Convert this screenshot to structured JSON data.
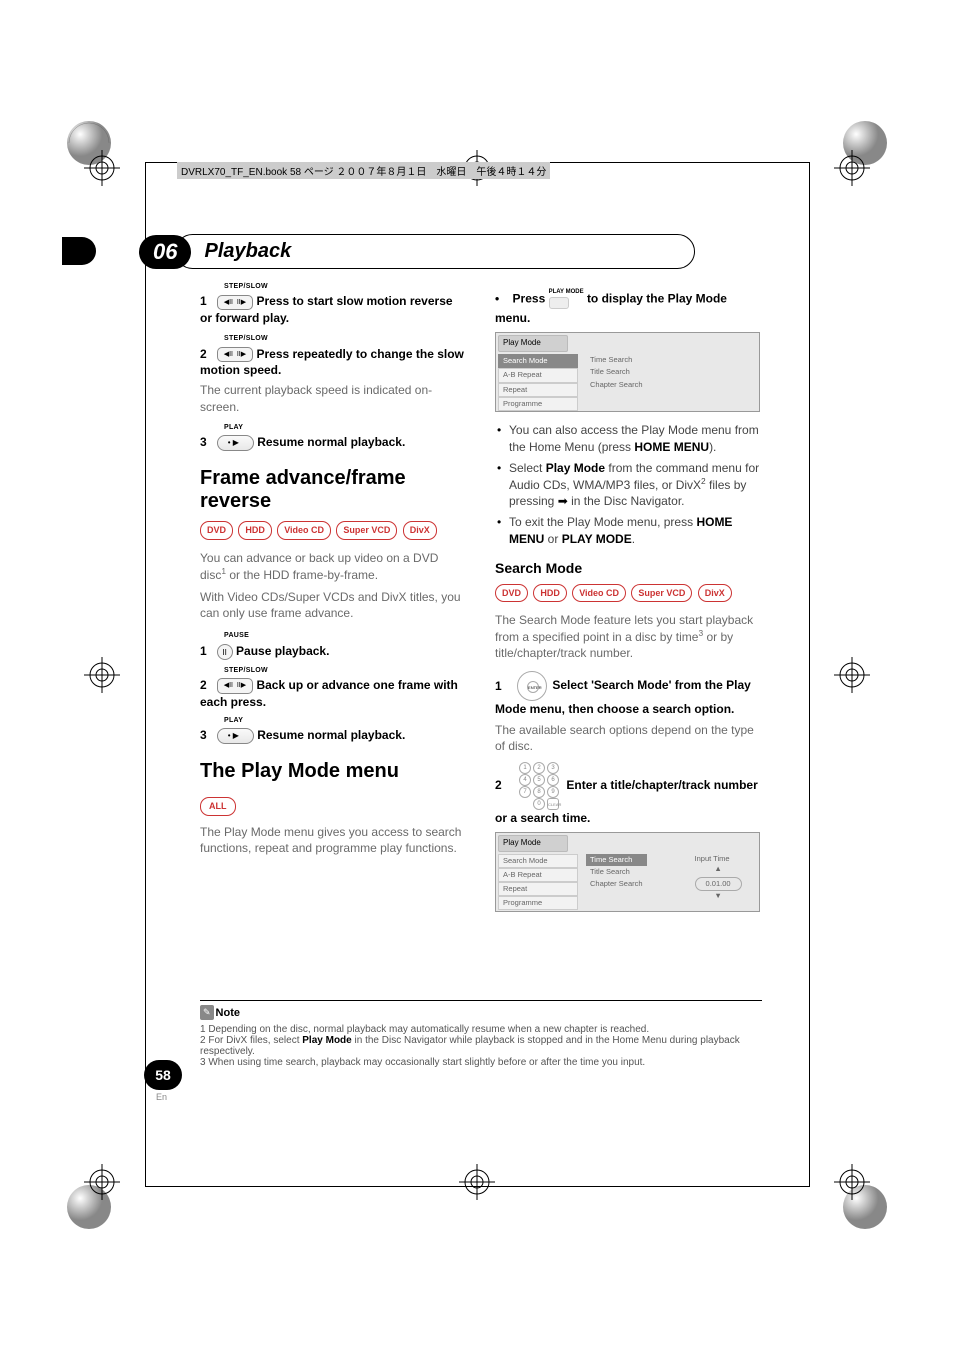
{
  "slug": "DVRLX70_TF_EN.book  58 ページ  ２００７年８月１日　水曜日　午後４時１４分",
  "chapter": {
    "num": "06",
    "title": "Playback"
  },
  "left": {
    "step1_lbl": "STEP/SLOW",
    "step1_n": "1",
    "step1_txt": "Press to start slow motion reverse or forward play.",
    "step2_lbl": "STEP/SLOW",
    "step2_n": "2",
    "step2_txt": "Press repeatedly to change the slow motion speed.",
    "speed_note": "The current playback speed is indicated on-screen.",
    "step3_lbl": "PLAY",
    "step3_n": "3",
    "step3_txt": "Resume normal playback.",
    "sec_frame": "Frame advance/frame reverse",
    "badges": [
      "DVD",
      "HDD",
      "Video CD",
      "Super VCD",
      "DivX"
    ],
    "frame_p1a": "You can advance or back up video on a DVD disc",
    "frame_p1b": " or the HDD frame-by-frame.",
    "frame_p2": "With Video CDs/Super VCDs and DivX titles, you can only use frame advance.",
    "fstep1_lbl": "PAUSE",
    "fstep1_n": "1",
    "fstep1_txt": "Pause playback.",
    "fstep2_lbl": "STEP/SLOW",
    "fstep2_n": "2",
    "fstep2_txt": "Back up or advance one frame with each press.",
    "fstep3_lbl": "PLAY",
    "fstep3_n": "3",
    "fstep3_txt": "Resume normal playback.",
    "sec_play": "The Play Mode menu",
    "all_badge": "ALL",
    "play_p": "The Play Mode menu gives you access to search functions, repeat and programme play functions."
  },
  "right": {
    "bullet_press_a": "Press ",
    "bullet_press_lbl": "PLAY MODE",
    "bullet_press_b": " to display the Play Mode menu.",
    "menu1": {
      "title": "Play Mode",
      "list": [
        "Search Mode",
        "A-B Repeat",
        "Repeat",
        "Programme"
      ],
      "opts": [
        "Time Search",
        "Title Search",
        "Chapter Search"
      ]
    },
    "b1a": "You can also access the Play Mode menu from the Home Menu (press ",
    "b1b": "HOME MENU",
    "b1c": ").",
    "b2a": "Select ",
    "b2b": "Play Mode",
    "b2c": " from the command menu for Audio CDs, WMA/MP3 files, or DivX",
    "b2d": " files by pressing ",
    "b2e": " in the Disc Navigator.",
    "b3a": "To exit the Play Mode menu, press ",
    "b3b": "HOME MENU",
    "b3c": " or ",
    "b3d": "PLAY MODE",
    "b3e": ".",
    "sub_search": "Search Mode",
    "badges": [
      "DVD",
      "HDD",
      "Video CD",
      "Super VCD",
      "DivX"
    ],
    "search_p1a": "The Search Mode feature lets you start playback from a specified point in a disc by time",
    "search_p1b": " or by title/chapter/track number.",
    "sstep1_n": "1",
    "sstep1_txt": "Select 'Search Mode' from the Play Mode menu, then choose a search option.",
    "search_p2": "The available search options depend on the type of disc.",
    "sstep2_n": "2",
    "sstep2_txt": "Enter a title/chapter/track number or a search time.",
    "menu2": {
      "title": "Play Mode",
      "list": [
        "Search Mode",
        "A-B Repeat",
        "Repeat",
        "Programme"
      ],
      "opts": [
        "Time Search",
        "Title Search",
        "Chapter Search"
      ],
      "input_label": "Input Time",
      "input_val": "0.01.00"
    }
  },
  "note": {
    "label": "Note",
    "n1": "1 Depending on the disc, normal playback may automatically resume when a new chapter is reached.",
    "n2a": "2 For DivX files, select ",
    "n2b": "Play Mode",
    "n2c": " in the Disc Navigator while playback is stopped and in the Home Menu during playback respectively.",
    "n3": "3 When using time search, playback may occasionally start slightly before or after the time you input."
  },
  "page": {
    "num": "58",
    "lang": "En"
  }
}
